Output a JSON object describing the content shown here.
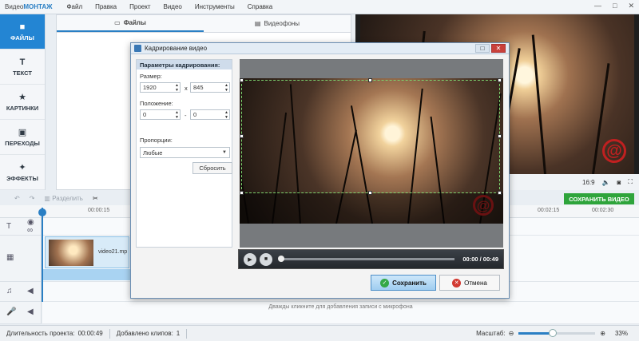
{
  "app": {
    "brand_prefix": "Видео",
    "brand_suffix": "МОНТАЖ",
    "menu": [
      "Файл",
      "Правка",
      "Проект",
      "Видео",
      "Инструменты",
      "Справка"
    ],
    "window_controls": [
      "—",
      "□",
      "✕"
    ]
  },
  "leftnav": [
    {
      "label": "ФАЙЛЫ",
      "icon": "folder-icon",
      "active": true
    },
    {
      "label": "ТЕКСТ",
      "icon": "text-icon",
      "active": false
    },
    {
      "label": "КАРТИНКИ",
      "icon": "star-icon",
      "active": false
    },
    {
      "label": "ПЕРЕХОДЫ",
      "icon": "transition-icon",
      "active": false
    },
    {
      "label": "ЭФФЕКТЫ",
      "icon": "magic-wand-icon",
      "active": false
    }
  ],
  "files_tabs": [
    {
      "label": "Файлы",
      "active": true
    },
    {
      "label": "Видеофоны",
      "active": false
    }
  ],
  "preview": {
    "aspect": "16:9"
  },
  "save_video_label": "СОХРАНИТЬ ВИДЕО",
  "timeline": {
    "split_label": "Разделить",
    "ticks": [
      "00:00:15",
      "00:02:15",
      "00:02:30"
    ],
    "clip_name": "video21.mp",
    "mic_hint": "Дважды кликните для добавления записи с микрофона"
  },
  "status": {
    "duration_label": "Длительность проекта:",
    "duration_value": "00:00:49",
    "clips_label": "Добавлено клипов:",
    "clips_value": "1",
    "zoom_label": "Масштаб:",
    "zoom_value": "33%",
    "zoom_fraction": 0.45
  },
  "dialog": {
    "title": "Кадрирование видео",
    "params_header": "Параметры кадрирования:",
    "size_label": "Размер:",
    "width": "1920",
    "height": "845",
    "size_sep": "x",
    "position_label": "Положение:",
    "pos_x": "0",
    "pos_y": "0",
    "pos_sep": "-",
    "ratio_label": "Пропорции:",
    "ratio_value": "Любые",
    "reset_label": "Сбросить",
    "time": "00:00 / 00:49",
    "ok_label": "Сохранить",
    "cancel_label": "Отмена"
  }
}
